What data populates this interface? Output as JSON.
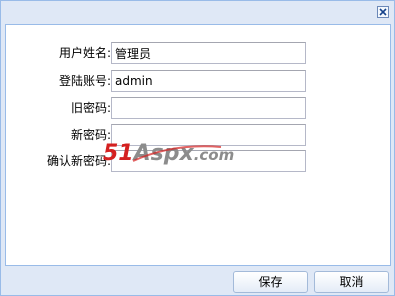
{
  "form": {
    "fields": [
      {
        "label": "用户姓名:",
        "value": "管理员",
        "placeholder": ""
      },
      {
        "label": "登陆账号:",
        "value": "admin",
        "placeholder": ""
      },
      {
        "label": "旧密码:",
        "value": "",
        "placeholder": ""
      },
      {
        "label": "新密码:",
        "value": "",
        "placeholder": ""
      },
      {
        "label": "确认新密码:",
        "value": "",
        "placeholder": ""
      }
    ]
  },
  "watermark": {
    "number": "51",
    "brand": "Aspx",
    "suffix": ".com"
  },
  "buttons": {
    "save": "保存",
    "cancel": "取消"
  },
  "icons": {
    "close": "close-icon"
  },
  "colors": {
    "frame": "#dfe8f6",
    "border": "#99bbe8",
    "watermark_red": "#d42020",
    "watermark_gray": "#8c8c8c"
  }
}
